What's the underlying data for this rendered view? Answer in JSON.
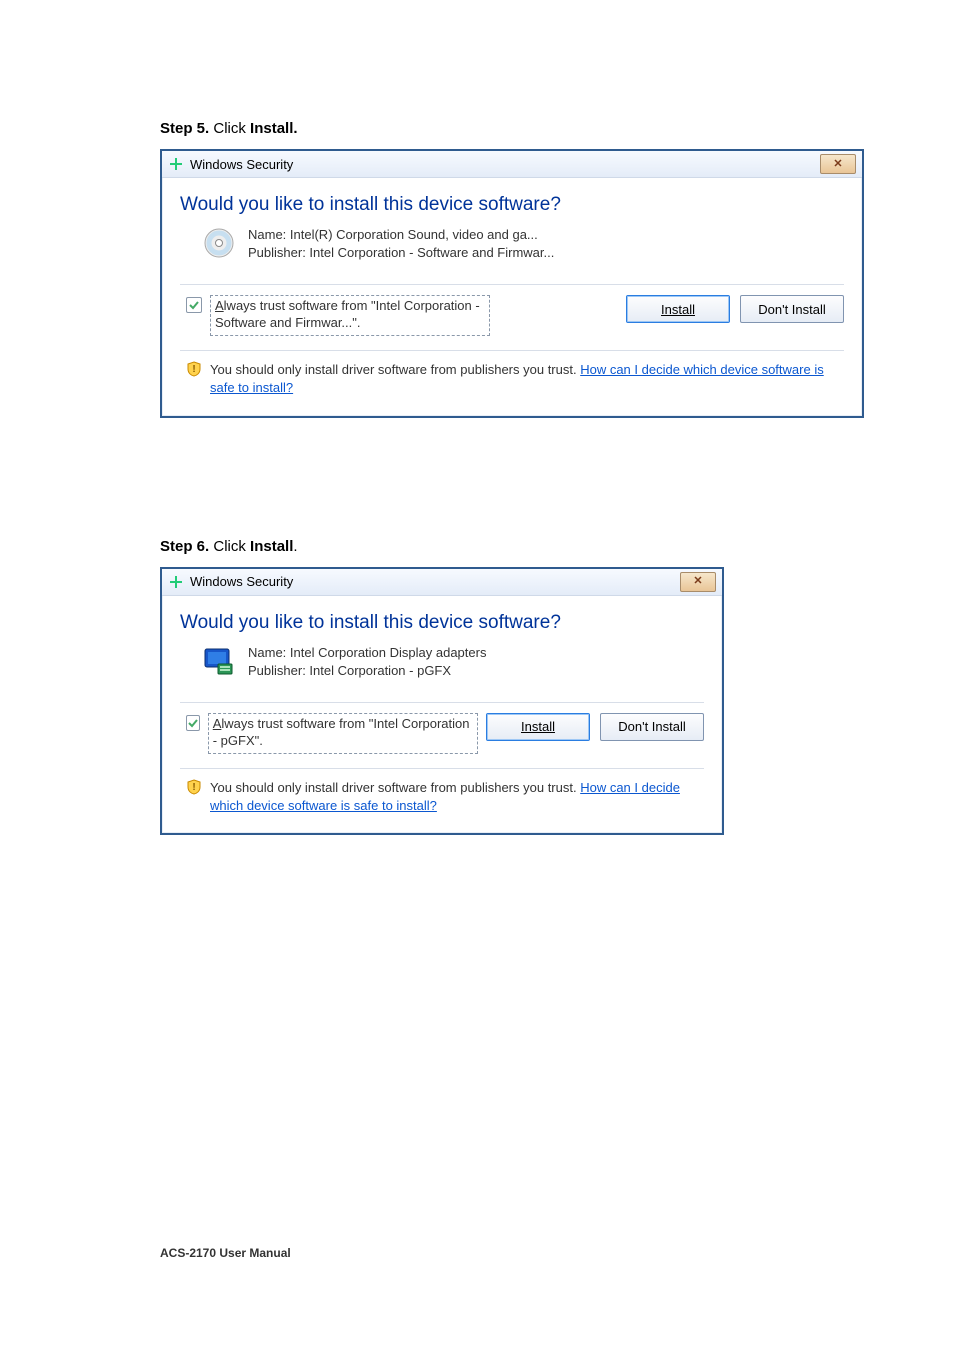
{
  "step5": {
    "step_prefix": "Step 5.",
    "step_mid": " Click ",
    "step_bold2": "Install.",
    "title": "Windows Security",
    "close_glyph": "✕",
    "question": "Would you like to install this device software?",
    "name_line": "Name: Intel(R) Corporation Sound, video and ga...",
    "pub_line": "Publisher: Intel Corporation - Software and Firmwar...",
    "trust_mnemonic": "A",
    "trust_rest": "lways trust software from \"Intel Corporation - Software and Firmwar...\".",
    "install_btn": "Install",
    "dont_btn": "Don't Install",
    "foot_plain": "You should only install driver software from publishers you trust.  ",
    "foot_link": "How can I decide which device software is safe to install?"
  },
  "step6": {
    "step_prefix": "Step 6.",
    "step_mid": " Click ",
    "step_bold2": "Install",
    "step_tail": ".",
    "title": "Windows Security",
    "close_glyph": "✕",
    "question": "Would you like to install this device software?",
    "name_line": "Name: Intel Corporation Display adapters",
    "pub_line": "Publisher: Intel Corporation - pGFX",
    "trust_mnemonic": "A",
    "trust_rest": "lways trust software from \"Intel Corporation - pGFX\".",
    "install_btn": "Install",
    "dont_btn": "Don't Install",
    "foot_plain": "You should only install driver software from publishers you trust.  ",
    "foot_link": "How can I decide which device software is safe to install?"
  },
  "footer": "ACS-2170 User Manual"
}
